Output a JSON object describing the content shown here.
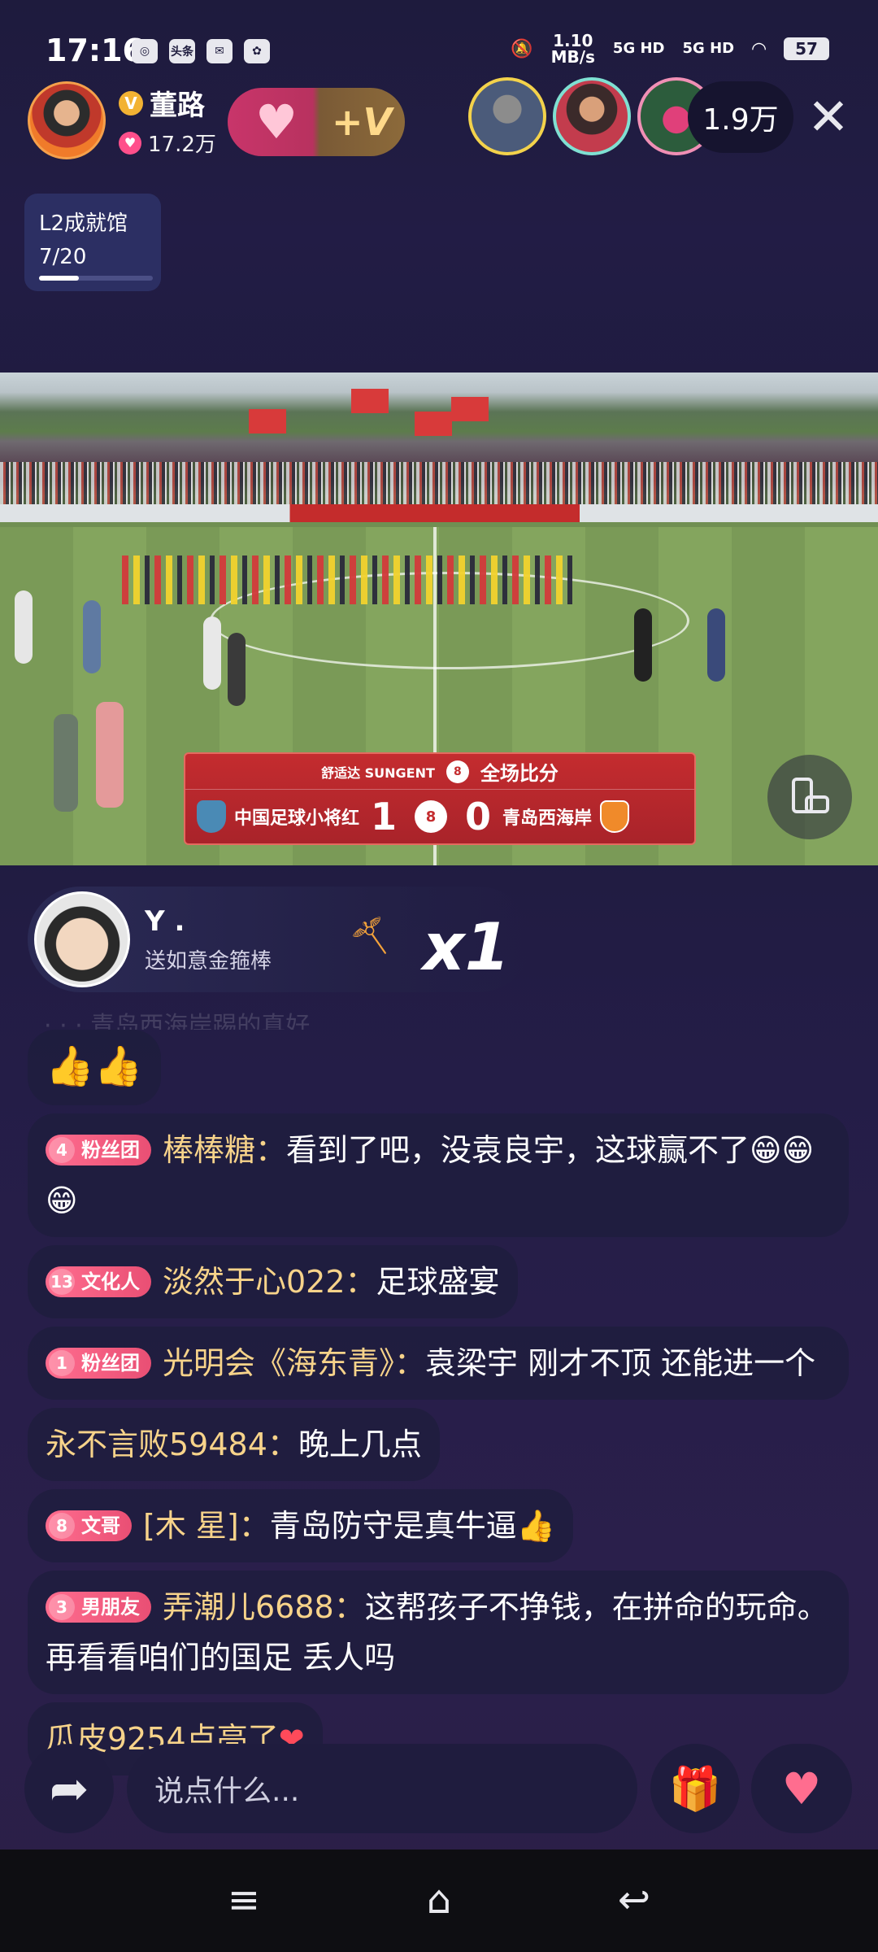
{
  "status_bar": {
    "time": "17:16",
    "app_icons": [
      "pic",
      "头条",
      "msg",
      "paw"
    ],
    "net_speed": "1.10",
    "net_unit": "MB/s",
    "signal1": "5G HD",
    "signal2": "5G HD",
    "battery": "57"
  },
  "host": {
    "name": "董路",
    "likes": "17.2万",
    "follow_plus": "+",
    "follow_v": "+V"
  },
  "viewers": {
    "count": "1.9万",
    "close": "✕"
  },
  "achievement": {
    "title": "L2成就馆",
    "progress": "7/20",
    "progress_fraction": 0.35
  },
  "scoreboard": {
    "sponsor": "舒适达 SUNGENT",
    "title": "全场比分",
    "team_home": "中国足球小将红",
    "score_home": "1",
    "score_away": "0",
    "team_away": "青岛西海岸"
  },
  "gift_banner": {
    "user": "Y .",
    "gift_desc": "送如意金箍棒",
    "count": "x1"
  },
  "chat": {
    "faded_top": "· · · 青岛西海岸踢的真好",
    "messages": [
      {
        "badge_level": "",
        "badge_label": "",
        "user": "",
        "text": "👍👍"
      },
      {
        "badge_level": "4",
        "badge_label": "粉丝团",
        "user": "棒棒糖：",
        "text": "看到了吧，没袁良宇，这球赢不了😁😁😁"
      },
      {
        "badge_level": "13",
        "badge_label": "文化人",
        "user": "淡然于心022：",
        "text": "足球盛宴"
      },
      {
        "badge_level": "1",
        "badge_label": "粉丝团",
        "user": "光明会《海东青》：",
        "text": "袁梁宇 刚才不顶 还能进一个"
      },
      {
        "badge_level": "",
        "badge_label": "",
        "user": "永不言败59484：",
        "text": "晚上几点"
      },
      {
        "badge_level": "8",
        "badge_label": "文哥",
        "user": "[木 星]：",
        "text": "青岛防守是真牛逼👍"
      },
      {
        "badge_level": "3",
        "badge_label": "男朋友",
        "user": "弄潮儿6688：",
        "text": "这帮孩子不挣钱，在拼命的玩命。再看看咱们的国足 丢人吗"
      },
      {
        "badge_level": "",
        "badge_label": "",
        "user": "瓜皮9254点亮了",
        "text": "❤"
      }
    ]
  },
  "input": {
    "placeholder": "说点什么..."
  },
  "colors": {
    "background": "#1e1b3d",
    "username": "#f7d38a",
    "badge": "#e94f74",
    "scoreboard": "#c42c2f"
  }
}
